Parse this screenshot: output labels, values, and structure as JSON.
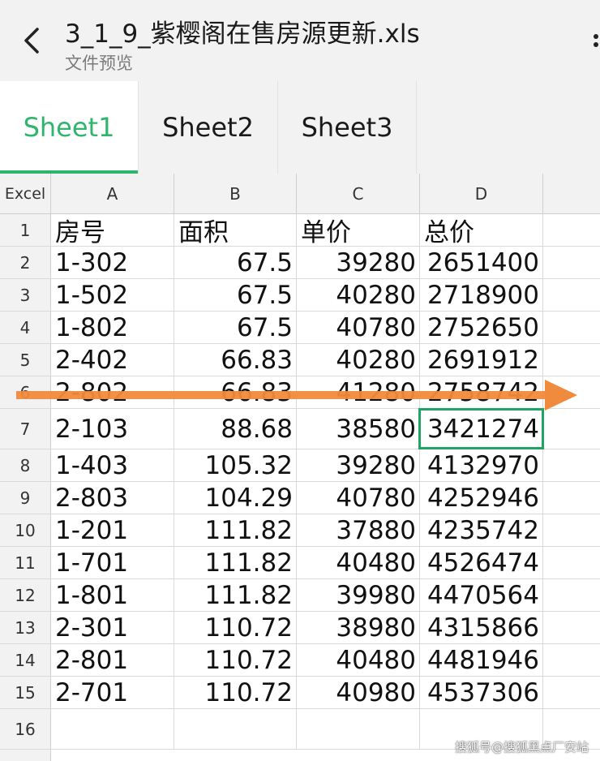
{
  "header": {
    "title": "3_1_9_紫樱阁在售房源更新.xls",
    "subtitle": "文件预览",
    "back_icon": "chevron-left-icon",
    "more_icon": "more-vertical-icon"
  },
  "tabs": [
    {
      "label": "Sheet1",
      "active": true
    },
    {
      "label": "Sheet2",
      "active": false
    },
    {
      "label": "Sheet3",
      "active": false
    }
  ],
  "colors": {
    "accent": "#2fb56c",
    "selection": "#1fa463",
    "arrow": "#f08a3c"
  },
  "grid": {
    "corner_label": "Excel",
    "columns": [
      "A",
      "B",
      "C",
      "D"
    ],
    "rows": [
      {
        "n": "1",
        "cells": [
          "房号",
          "面积",
          "单价",
          "总价"
        ]
      },
      {
        "n": "2",
        "cells": [
          "1-302",
          "67.5",
          "39280",
          "2651400"
        ]
      },
      {
        "n": "3",
        "cells": [
          "1-502",
          "67.5",
          "40280",
          "2718900"
        ]
      },
      {
        "n": "4",
        "cells": [
          "1-802",
          "67.5",
          "40780",
          "2752650"
        ]
      },
      {
        "n": "5",
        "cells": [
          "2-402",
          "66.83",
          "40280",
          "2691912"
        ]
      },
      {
        "n": "6",
        "cells": [
          "2-802",
          "66.83",
          "41280",
          "2758742"
        ]
      },
      {
        "n": "7",
        "cells": [
          "2-103",
          "88.68",
          "38580",
          "3421274"
        ]
      },
      {
        "n": "8",
        "cells": [
          "1-403",
          "105.32",
          "39280",
          "4132970"
        ]
      },
      {
        "n": "9",
        "cells": [
          "2-803",
          "104.29",
          "40780",
          "4252946"
        ]
      },
      {
        "n": "10",
        "cells": [
          "1-201",
          "111.82",
          "37880",
          "4235742"
        ]
      },
      {
        "n": "11",
        "cells": [
          "1-701",
          "111.82",
          "40480",
          "4526474"
        ]
      },
      {
        "n": "12",
        "cells": [
          "1-801",
          "111.82",
          "39980",
          "4470564"
        ]
      },
      {
        "n": "13",
        "cells": [
          "2-301",
          "110.72",
          "38980",
          "4315866"
        ]
      },
      {
        "n": "14",
        "cells": [
          "2-801",
          "110.72",
          "40480",
          "4481946"
        ]
      },
      {
        "n": "15",
        "cells": [
          "2-701",
          "110.72",
          "40980",
          "4537306"
        ]
      },
      {
        "n": "16",
        "cells": [
          "",
          "",
          "",
          ""
        ]
      }
    ],
    "selected": {
      "row": "7",
      "column": "D"
    }
  },
  "overlay": {
    "arrow_icon": "right-arrow-annotation-icon"
  },
  "watermark": "搜狐号@搜狐黑点厂安站"
}
